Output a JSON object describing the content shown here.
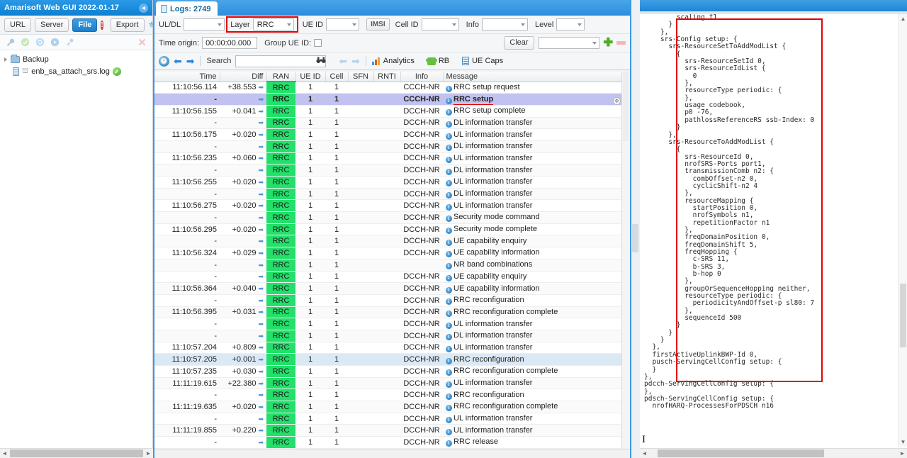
{
  "left_panel": {
    "title": "Amarisoft Web GUI 2022-01-17",
    "collapse_icon": "chevron-left-icon",
    "toolbar": {
      "url_label": "URL",
      "server_label": "Server",
      "file_label": "File",
      "error_badge": "!",
      "export_label": "Export",
      "plug_icon": "plug-icon"
    },
    "toolbar2_icons": [
      "wrench-icon",
      "check-circle-icon",
      "refresh-icon",
      "play-icon",
      "plug-small-icon",
      "close-x-icon"
    ],
    "tree": [
      {
        "label": "Backup",
        "type": "folder",
        "expanded": false
      },
      {
        "label": "enb_sa_attach_srs.log",
        "type": "file",
        "status": "ok"
      }
    ]
  },
  "mid_panel": {
    "tab": {
      "label": "Logs: 2749",
      "icon": "log-page-icon"
    },
    "filters": {
      "uldl_label": "UL/DL",
      "uldl_value": "",
      "layer_label": "Layer",
      "layer_value": "RRC",
      "ueid_label": "UE ID",
      "ueid_value": "",
      "imsi_label": "IMSI",
      "cellid_label": "Cell ID",
      "cellid_value": "",
      "info_label": "Info",
      "info_value": "",
      "level_label": "Level",
      "level_value": ""
    },
    "row2": {
      "time_origin_label": "Time origin:",
      "time_origin_value": "00:00:00.000",
      "group_ueid_label": "Group UE ID:",
      "clear_label": "Clear",
      "preset_value": "",
      "add_icon": "plus-icon",
      "remove_icon": "minus-icon"
    },
    "actions": {
      "clock_icon": "clock-icon",
      "prev_icon": "arrow-left-icon",
      "next_icon": "arrow-right-icon",
      "search_label": "Search",
      "search_value": "",
      "binoculars_icon": "binoculars-icon",
      "search_prev_icon": "arrow-left-dim-icon",
      "search_next_icon": "arrow-right-dim-icon",
      "analytics_label": "Analytics",
      "rb_label": "RB",
      "uecaps_label": "UE Caps"
    },
    "table": {
      "columns": [
        "Time",
        "Diff",
        "RAN",
        "UE ID",
        "Cell",
        "SFN",
        "RNTI",
        "Info",
        "Message"
      ],
      "rows": [
        {
          "time": "11:10:56.114",
          "diff": "+38.553",
          "ran": "RRC",
          "ueid": "1",
          "cell": "1",
          "sfn": "",
          "rnti": "",
          "info": "CCCH-NR",
          "msg": "RRC setup request",
          "state": "normal"
        },
        {
          "time": "-",
          "diff": "",
          "ran": "RRC",
          "ueid": "1",
          "cell": "1",
          "sfn": "",
          "rnti": "",
          "info": "CCCH-NR",
          "msg": "RRC setup",
          "state": "selected"
        },
        {
          "time": "11:10:56.155",
          "diff": "+0.041",
          "ran": "RRC",
          "ueid": "1",
          "cell": "1",
          "sfn": "",
          "rnti": "",
          "info": "DCCH-NR",
          "msg": "RRC setup complete",
          "state": "normal"
        },
        {
          "time": "-",
          "diff": "",
          "ran": "RRC",
          "ueid": "1",
          "cell": "1",
          "sfn": "",
          "rnti": "",
          "info": "DCCH-NR",
          "msg": "DL information transfer",
          "state": "normal"
        },
        {
          "time": "11:10:56.175",
          "diff": "+0.020",
          "ran": "RRC",
          "ueid": "1",
          "cell": "1",
          "sfn": "",
          "rnti": "",
          "info": "DCCH-NR",
          "msg": "UL information transfer",
          "state": "normal"
        },
        {
          "time": "-",
          "diff": "",
          "ran": "RRC",
          "ueid": "1",
          "cell": "1",
          "sfn": "",
          "rnti": "",
          "info": "DCCH-NR",
          "msg": "DL information transfer",
          "state": "normal"
        },
        {
          "time": "11:10:56.235",
          "diff": "+0.060",
          "ran": "RRC",
          "ueid": "1",
          "cell": "1",
          "sfn": "",
          "rnti": "",
          "info": "DCCH-NR",
          "msg": "UL information transfer",
          "state": "normal"
        },
        {
          "time": "-",
          "diff": "",
          "ran": "RRC",
          "ueid": "1",
          "cell": "1",
          "sfn": "",
          "rnti": "",
          "info": "DCCH-NR",
          "msg": "DL information transfer",
          "state": "normal"
        },
        {
          "time": "11:10:56.255",
          "diff": "+0.020",
          "ran": "RRC",
          "ueid": "1",
          "cell": "1",
          "sfn": "",
          "rnti": "",
          "info": "DCCH-NR",
          "msg": "UL information transfer",
          "state": "normal"
        },
        {
          "time": "-",
          "diff": "",
          "ran": "RRC",
          "ueid": "1",
          "cell": "1",
          "sfn": "",
          "rnti": "",
          "info": "DCCH-NR",
          "msg": "DL information transfer",
          "state": "normal"
        },
        {
          "time": "11:10:56.275",
          "diff": "+0.020",
          "ran": "RRC",
          "ueid": "1",
          "cell": "1",
          "sfn": "",
          "rnti": "",
          "info": "DCCH-NR",
          "msg": "UL information transfer",
          "state": "normal"
        },
        {
          "time": "-",
          "diff": "",
          "ran": "RRC",
          "ueid": "1",
          "cell": "1",
          "sfn": "",
          "rnti": "",
          "info": "DCCH-NR",
          "msg": "Security mode command",
          "state": "normal"
        },
        {
          "time": "11:10:56.295",
          "diff": "+0.020",
          "ran": "RRC",
          "ueid": "1",
          "cell": "1",
          "sfn": "",
          "rnti": "",
          "info": "DCCH-NR",
          "msg": "Security mode complete",
          "state": "normal"
        },
        {
          "time": "-",
          "diff": "",
          "ran": "RRC",
          "ueid": "1",
          "cell": "1",
          "sfn": "",
          "rnti": "",
          "info": "DCCH-NR",
          "msg": "UE capability enquiry",
          "state": "normal"
        },
        {
          "time": "11:10:56.324",
          "diff": "+0.029",
          "ran": "RRC",
          "ueid": "1",
          "cell": "1",
          "sfn": "",
          "rnti": "",
          "info": "DCCH-NR",
          "msg": "UE capability information",
          "state": "normal"
        },
        {
          "time": "-",
          "diff": "",
          "ran": "RRC",
          "ueid": "1",
          "cell": "1",
          "sfn": "",
          "rnti": "",
          "info": "",
          "msg": "NR band combinations",
          "state": "normal"
        },
        {
          "time": "-",
          "diff": "",
          "ran": "RRC",
          "ueid": "1",
          "cell": "1",
          "sfn": "",
          "rnti": "",
          "info": "DCCH-NR",
          "msg": "UE capability enquiry",
          "state": "normal"
        },
        {
          "time": "11:10:56.364",
          "diff": "+0.040",
          "ran": "RRC",
          "ueid": "1",
          "cell": "1",
          "sfn": "",
          "rnti": "",
          "info": "DCCH-NR",
          "msg": "UE capability information",
          "state": "normal"
        },
        {
          "time": "-",
          "diff": "",
          "ran": "RRC",
          "ueid": "1",
          "cell": "1",
          "sfn": "",
          "rnti": "",
          "info": "DCCH-NR",
          "msg": "RRC reconfiguration",
          "state": "normal"
        },
        {
          "time": "11:10:56.395",
          "diff": "+0.031",
          "ran": "RRC",
          "ueid": "1",
          "cell": "1",
          "sfn": "",
          "rnti": "",
          "info": "DCCH-NR",
          "msg": "RRC reconfiguration complete",
          "state": "normal"
        },
        {
          "time": "-",
          "diff": "",
          "ran": "RRC",
          "ueid": "1",
          "cell": "1",
          "sfn": "",
          "rnti": "",
          "info": "DCCH-NR",
          "msg": "UL information transfer",
          "state": "normal"
        },
        {
          "time": "-",
          "diff": "",
          "ran": "RRC",
          "ueid": "1",
          "cell": "1",
          "sfn": "",
          "rnti": "",
          "info": "DCCH-NR",
          "msg": "DL information transfer",
          "state": "normal"
        },
        {
          "time": "11:10:57.204",
          "diff": "+0.809",
          "ran": "RRC",
          "ueid": "1",
          "cell": "1",
          "sfn": "",
          "rnti": "",
          "info": "DCCH-NR",
          "msg": "UL information transfer",
          "state": "normal"
        },
        {
          "time": "11:10:57.205",
          "diff": "+0.001",
          "ran": "RRC",
          "ueid": "1",
          "cell": "1",
          "sfn": "",
          "rnti": "",
          "info": "DCCH-NR",
          "msg": "RRC reconfiguration",
          "state": "highlight"
        },
        {
          "time": "11:10:57.235",
          "diff": "+0.030",
          "ran": "RRC",
          "ueid": "1",
          "cell": "1",
          "sfn": "",
          "rnti": "",
          "info": "DCCH-NR",
          "msg": "RRC reconfiguration complete",
          "state": "normal"
        },
        {
          "time": "11:11:19.615",
          "diff": "+22.380",
          "ran": "RRC",
          "ueid": "1",
          "cell": "1",
          "sfn": "",
          "rnti": "",
          "info": "DCCH-NR",
          "msg": "UL information transfer",
          "state": "normal"
        },
        {
          "time": "-",
          "diff": "",
          "ran": "RRC",
          "ueid": "1",
          "cell": "1",
          "sfn": "",
          "rnti": "",
          "info": "DCCH-NR",
          "msg": "RRC reconfiguration",
          "state": "normal"
        },
        {
          "time": "11:11:19.635",
          "diff": "+0.020",
          "ran": "RRC",
          "ueid": "1",
          "cell": "1",
          "sfn": "",
          "rnti": "",
          "info": "DCCH-NR",
          "msg": "RRC reconfiguration complete",
          "state": "normal"
        },
        {
          "time": "-",
          "diff": "",
          "ran": "RRC",
          "ueid": "1",
          "cell": "1",
          "sfn": "",
          "rnti": "",
          "info": "DCCH-NR",
          "msg": "UL information transfer",
          "state": "normal"
        },
        {
          "time": "11:11:19.855",
          "diff": "+0.220",
          "ran": "RRC",
          "ueid": "1",
          "cell": "1",
          "sfn": "",
          "rnti": "",
          "info": "DCCH-NR",
          "msg": "UL information transfer",
          "state": "normal"
        },
        {
          "time": "-",
          "diff": "",
          "ran": "RRC",
          "ueid": "1",
          "cell": "1",
          "sfn": "",
          "rnti": "",
          "info": "DCCH-NR",
          "msg": "RRC release",
          "state": "normal"
        }
      ]
    }
  },
  "right_panel": {
    "detail_text": "        scaling f1\n      }\n    },\n    srs-Config setup: {\n      srs-ResourceSetToAddModList {\n        {\n          srs-ResourceSetId 0,\n          srs-ResourceIdList {\n            0\n          },\n          resourceType periodic: {\n          },\n          usage codebook,\n          p0 -76,\n          pathlossReferenceRS ssb-Index: 0\n        }\n      },\n      srs-ResourceToAddModList {\n        {\n          srs-ResourceId 0,\n          nrofSRS-Ports port1,\n          transmissionComb n2: {\n            combOffset-n2 0,\n            cyclicShift-n2 4\n          },\n          resourceMapping {\n            startPosition 0,\n            nrofSymbols n1,\n            repetitionFactor n1\n          },\n          freqDomainPosition 0,\n          freqDomainShift 5,\n          freqHopping {\n            c-SRS 11,\n            b-SRS 3,\n            b-hop 0\n          },\n          groupOrSequenceHopping neither,\n          resourceType periodic: {\n            periodicityAndOffset-p sl80: 7\n          },\n          sequenceId 500\n        }\n      }\n    }\n  },\n  firstActiveUplinkBWP-Id 0,\n  pusch-ServingCellConfig setup: {\n  }\n},\npdcch-ServingCellConfig setup: {\n},\npdsch-ServingCellConfig setup: {\n  nrofHARQ-ProcessesForPDSCH n16"
  },
  "colors": {
    "brand_blue": "#2b8ddd",
    "ran_green": "#22e06a",
    "selection_purple": "#c2c2f0",
    "highlight_blue": "#dbe9f5",
    "annotation_red": "#e60000"
  }
}
